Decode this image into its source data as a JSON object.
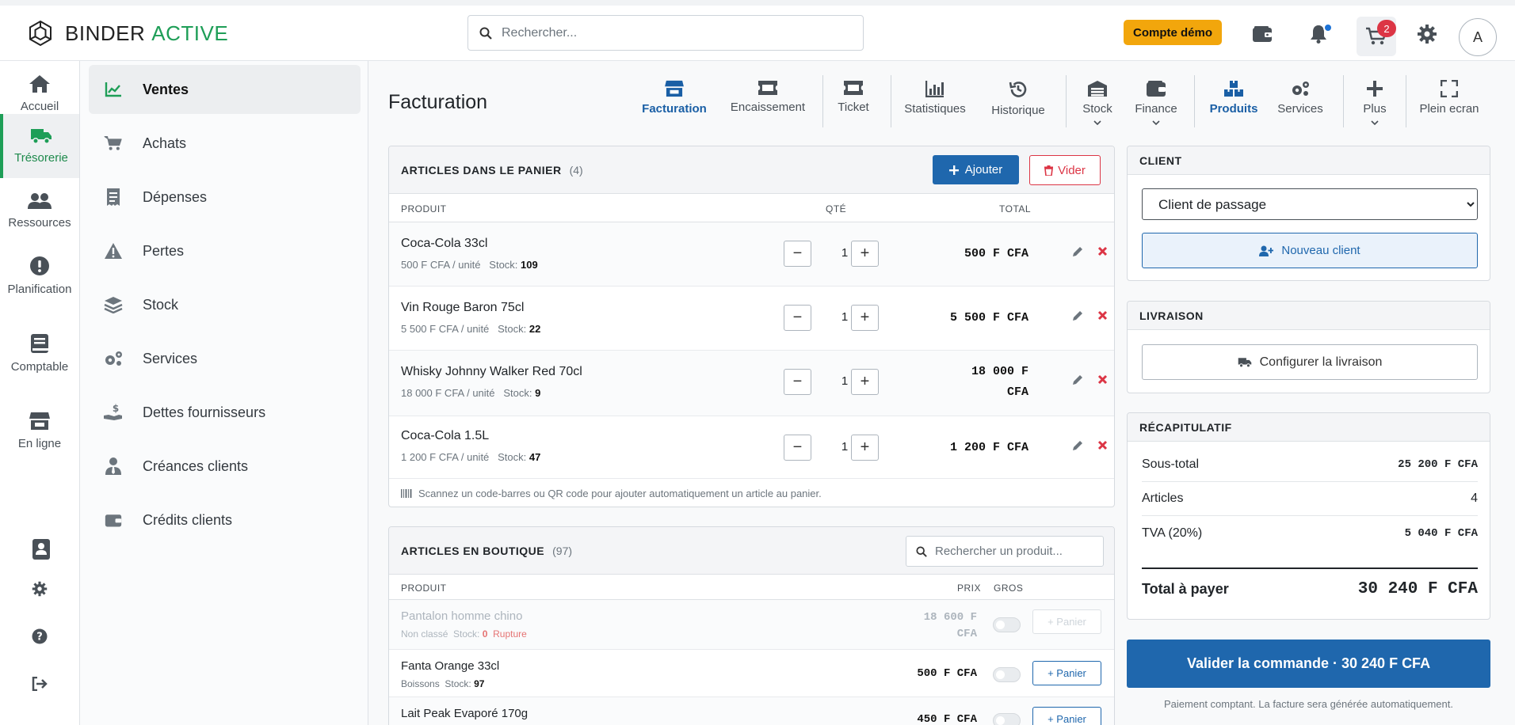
{
  "app": {
    "name_part1": "BINDER",
    "name_part2": "ACTIVE"
  },
  "header": {
    "search_placeholder": "Rechercher...",
    "demo_label": "Compte démo",
    "cart_count": "2",
    "avatar_initial": "A"
  },
  "rail": {
    "items": [
      {
        "label": "Accueil"
      },
      {
        "label": "Trésorerie"
      },
      {
        "label": "Ressources"
      },
      {
        "label": "Planification"
      },
      {
        "label": "Comptable"
      },
      {
        "label": "En ligne"
      }
    ]
  },
  "submenu": {
    "items": [
      {
        "label": "Ventes"
      },
      {
        "label": "Achats"
      },
      {
        "label": "Dépenses"
      },
      {
        "label": "Pertes"
      },
      {
        "label": "Stock"
      },
      {
        "label": "Services"
      },
      {
        "label": "Dettes fournisseurs"
      },
      {
        "label": "Créances clients"
      },
      {
        "label": "Crédits clients"
      }
    ]
  },
  "page": {
    "title": "Facturation"
  },
  "tabs": [
    {
      "label": "Facturation"
    },
    {
      "label": "Encaissement"
    },
    {
      "label": "Ticket"
    },
    {
      "label": "Statistiques"
    },
    {
      "label": "Historique"
    },
    {
      "label": "Stock"
    },
    {
      "label": "Finance"
    },
    {
      "label": "Produits"
    },
    {
      "label": "Services"
    },
    {
      "label": "Plus"
    },
    {
      "label": "Plein ecran"
    }
  ],
  "cart": {
    "title": "ARTICLES DANS LE PANIER",
    "count": "(4)",
    "add_label": "Ajouter",
    "clear_label": "Vider",
    "col_product": "PRODUIT",
    "col_qty": "QTÉ",
    "col_total": "TOTAL",
    "stock_label": "Stock:",
    "rows": [
      {
        "name": "Coca-Cola 33cl",
        "unit": "500 F CFA / unité",
        "stock": "109",
        "qty": "1",
        "total": "500 F CFA"
      },
      {
        "name": "Vin Rouge Baron 75cl",
        "unit": "5 500 F CFA / unité",
        "stock": "22",
        "qty": "1",
        "total": "5 500 F CFA"
      },
      {
        "name": "Whisky Johnny Walker Red 70cl",
        "unit": "18 000 F CFA / unité",
        "stock": "9",
        "qty": "1",
        "total_line1": "18 000 F",
        "total_line2": "CFA"
      },
      {
        "name": "Coca-Cola 1.5L",
        "unit": "1 200 F CFA / unité",
        "stock": "47",
        "qty": "1",
        "total": "1 200 F CFA"
      }
    ],
    "scan_hint": "Scannez un code-barres ou QR code pour ajouter automatiquement un article au panier."
  },
  "shop": {
    "title": "ARTICLES EN BOUTIQUE",
    "count": "(97)",
    "search_placeholder": "Rechercher un produit...",
    "col_product": "PRODUIT",
    "col_price": "PRIX",
    "col_gros": "GROS",
    "stock_label": "Stock:",
    "panier_label": "+ Panier",
    "rows": [
      {
        "name": "Pantalon homme chino",
        "category": "Non classé",
        "stock": "0",
        "status": "Rupture",
        "price_line1": "18 600 F",
        "price_line2": "CFA"
      },
      {
        "name": "Fanta Orange 33cl",
        "category": "Boissons",
        "stock": "97",
        "price": "500 F CFA"
      },
      {
        "name": "Lait Peak Evaporé 170g",
        "price": "450 F CFA"
      }
    ]
  },
  "client": {
    "title": "CLIENT",
    "selected": "Client de passage",
    "new_label": "Nouveau client"
  },
  "delivery": {
    "title": "LIVRAISON",
    "config_label": "Configurer la livraison"
  },
  "recap": {
    "title": "RÉCAPITULATIF",
    "subtotal_label": "Sous-total",
    "subtotal": "25 200 F CFA",
    "articles_label": "Articles",
    "articles": "4",
    "tva_label": "TVA (20%)",
    "tva": "5 040 F CFA",
    "total_label": "Total à payer",
    "total": "30 240 F CFA"
  },
  "validate_label": "Valider la commande · 30 240 F CFA",
  "payment_note": "Paiement comptant. La facture sera générée automatiquement.",
  "colors": {
    "brand_green": "#1e9e57",
    "primary": "#1f67ad",
    "danger": "#dc3545",
    "warning": "#f2a60c"
  }
}
